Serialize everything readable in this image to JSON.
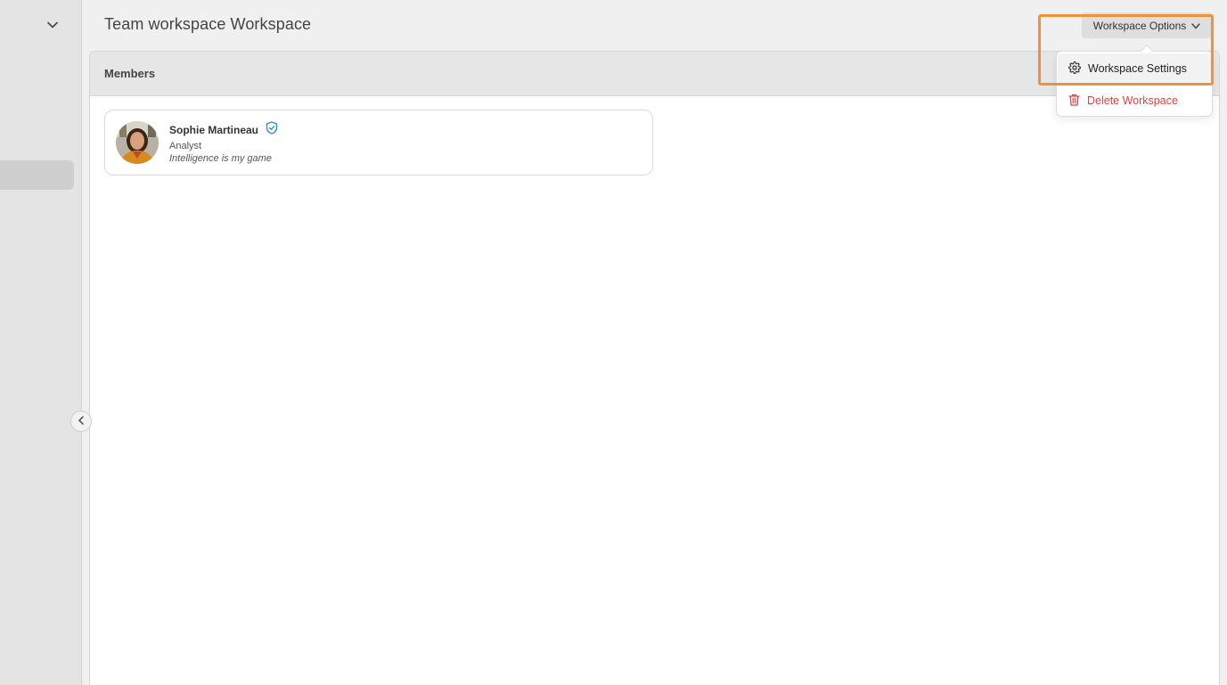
{
  "header": {
    "title": "Team workspace Workspace",
    "options_label": "Workspace Options"
  },
  "members": {
    "title": "Members",
    "items": [
      {
        "name": "Sophie Martineau",
        "role": "Analyst",
        "bio": "Intelligence is my game",
        "verified": true
      }
    ]
  },
  "dropdown": {
    "settings_label": "Workspace Settings",
    "delete_label": "Delete Workspace"
  },
  "icons": {
    "sidebar_toggle": "chevron-down-icon",
    "collapse": "chevron-left-icon",
    "options": "chevron-down-icon",
    "verified": "shield-check-icon",
    "settings": "gear-icon",
    "delete": "trash-icon"
  },
  "colors": {
    "accent_verified": "#2b8ec9",
    "danger": "#d94444",
    "highlight": "#f0923a"
  }
}
